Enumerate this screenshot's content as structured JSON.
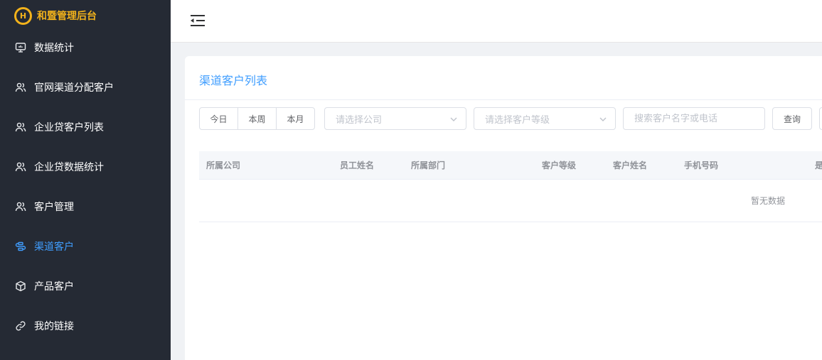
{
  "brand": {
    "logo_letter": "H",
    "title": "和暨管理后台"
  },
  "sidebar": {
    "items": [
      {
        "label": "数据统计",
        "icon": "monitor-icon",
        "active": false
      },
      {
        "label": "官网渠道分配客户",
        "icon": "users-icon",
        "active": false
      },
      {
        "label": "企业贷客户列表",
        "icon": "users-icon",
        "active": false
      },
      {
        "label": "企业贷数据统计",
        "icon": "users-icon",
        "active": false
      },
      {
        "label": "客户管理",
        "icon": "users-icon",
        "active": false
      },
      {
        "label": "渠道客户",
        "icon": "channel-icon",
        "active": true
      },
      {
        "label": "产品客户",
        "icon": "box-icon",
        "active": false
      },
      {
        "label": "我的链接",
        "icon": "link-icon",
        "active": false
      }
    ]
  },
  "header": {
    "fold_icon": "fold-icon"
  },
  "main": {
    "title": "渠道客户列表",
    "filters": {
      "date_buttons": [
        "今日",
        "本周",
        "本月"
      ],
      "company_select_placeholder": "请选择公司",
      "level_select_placeholder": "请选择客户等级",
      "search_placeholder": "搜索客户名字或电话",
      "query_label": "查询"
    },
    "table": {
      "columns": [
        "所属公司",
        "员工姓名",
        "所属部门",
        "客户等级",
        "客户姓名",
        "手机号码",
        "是"
      ],
      "empty_text": "暂无数据"
    }
  },
  "colors": {
    "sidebar_bg": "#252a34",
    "brand": "#f2b21b",
    "accent": "#409eff"
  }
}
